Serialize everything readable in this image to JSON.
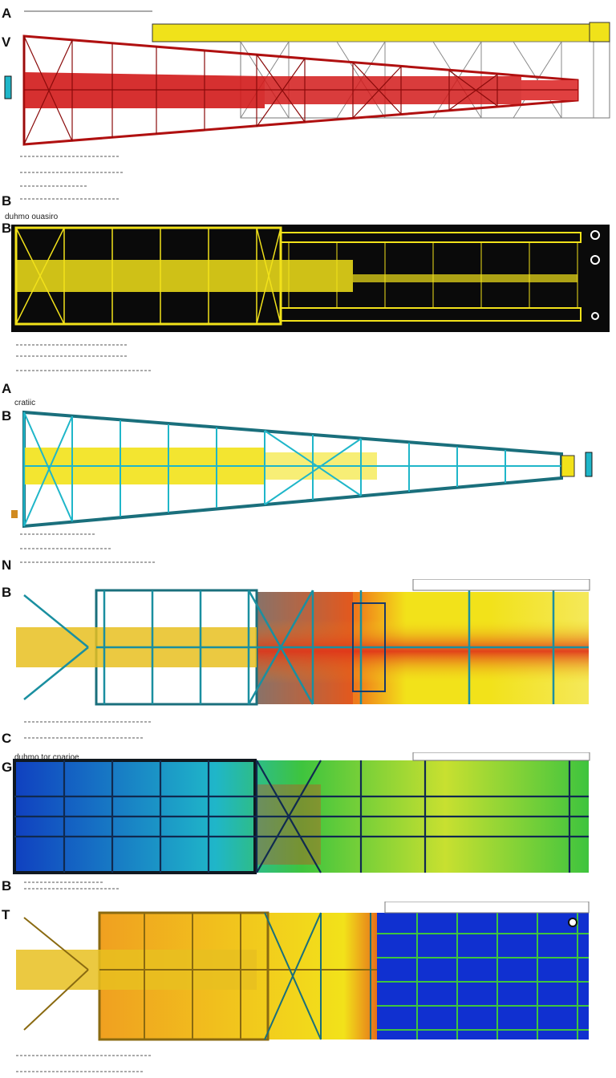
{
  "panels": [
    {
      "letters": [
        "A",
        "V"
      ],
      "caption": "",
      "bottom_letter": "B"
    },
    {
      "letters": [
        "B"
      ],
      "caption": "duhmo ouasiro",
      "bottom_letter": "A"
    },
    {
      "letters": [
        "B"
      ],
      "caption": "cratiic",
      "bottom_letter": "N"
    },
    {
      "letters": [
        "B"
      ],
      "caption": "",
      "bottom_letter": "C"
    },
    {
      "letters": [
        "G"
      ],
      "caption": "duhmo tor cnarioe",
      "bottom_letter": "B"
    },
    {
      "letters": [
        "T"
      ],
      "caption": "",
      "bottom_letter": ""
    }
  ],
  "colors": {
    "red_truss": "#d21a1a",
    "yellow_truss": "#f2e21a",
    "cyan_truss": "#1fb6c9",
    "blue_field": "#1030d0",
    "green_field": "#3ec43e",
    "orange_field": "#f07a1a",
    "dark_bg": "#0a0a0a"
  }
}
